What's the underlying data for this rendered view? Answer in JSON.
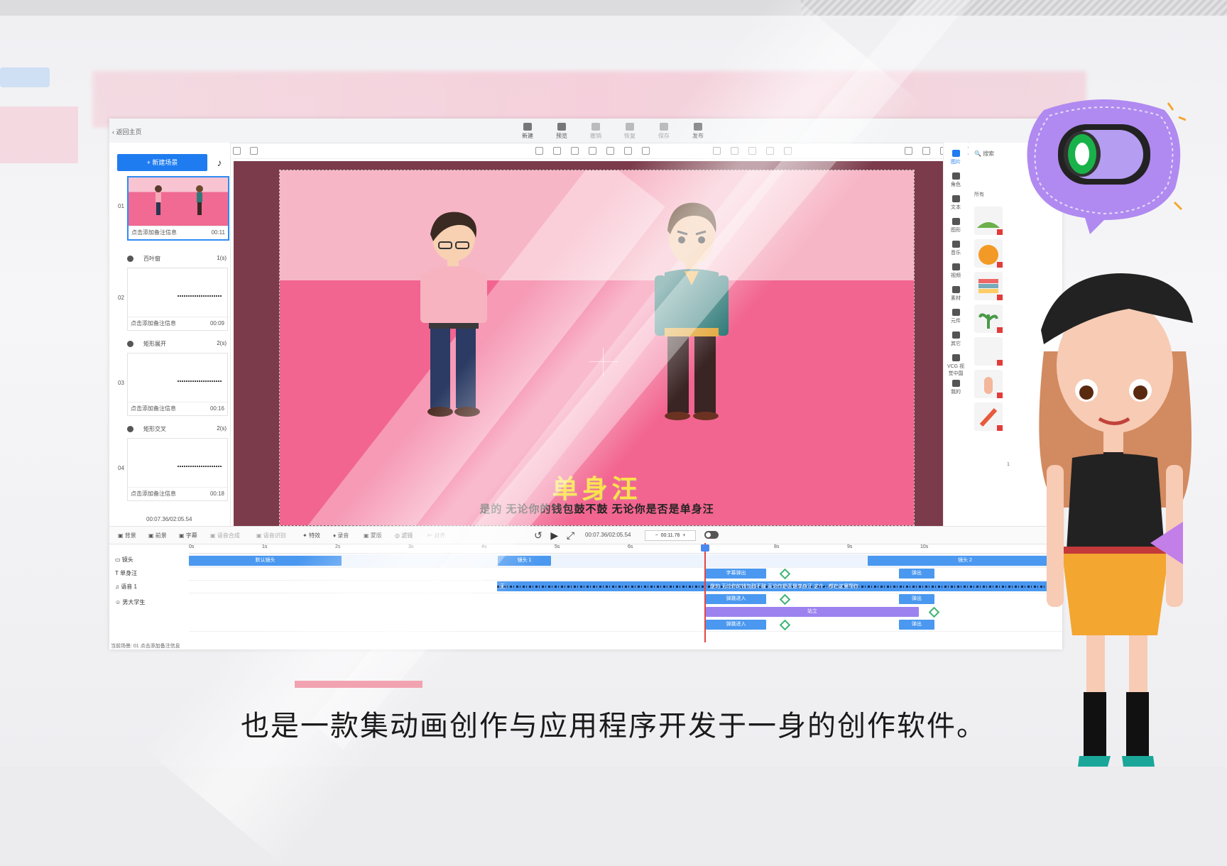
{
  "window": {
    "back_label": "返回主页"
  },
  "top_tools": [
    {
      "label": "新建",
      "icon": "new-icon",
      "enabled": true
    },
    {
      "label": "预览",
      "icon": "play-icon",
      "enabled": true
    },
    {
      "label": "撤销",
      "icon": "undo-icon",
      "enabled": false
    },
    {
      "label": "恢复",
      "icon": "redo-icon",
      "enabled": false
    },
    {
      "label": "保存",
      "icon": "save-icon",
      "enabled": false
    },
    {
      "label": "发布",
      "icon": "publish-icon",
      "enabled": true
    }
  ],
  "scenes_panel": {
    "new_scene_label": "+ 新建场景",
    "scenes": [
      {
        "num": "01",
        "note": "点击添加备注信息",
        "duration": "00:11"
      },
      {
        "num": "02",
        "note": "点击添加备注信息",
        "duration": "00:09"
      },
      {
        "num": "03",
        "note": "点击添加备注信息",
        "duration": "00:16"
      },
      {
        "num": "04",
        "note": "点击添加备注信息",
        "duration": "00:18"
      }
    ],
    "transitions": [
      {
        "name": "百叶窗",
        "duration": "1(s)"
      },
      {
        "name": "矩形展开",
        "duration": "2(s)"
      },
      {
        "name": "矩形交叉",
        "duration": "2(s)"
      }
    ],
    "total_time": "00:07.36/02:05.54"
  },
  "canvas": {
    "title": "单身汪",
    "subtitle": "是的 无论你的钱包鼓不鼓 无论你是否是单身汪"
  },
  "right_tabs": [
    {
      "label": "图片",
      "icon": "image-icon",
      "active": true
    },
    {
      "label": "角色",
      "icon": "character-icon",
      "active": false
    },
    {
      "label": "文本",
      "icon": "text-icon",
      "active": false
    },
    {
      "label": "图形",
      "icon": "shape-icon",
      "active": false
    },
    {
      "label": "音乐",
      "icon": "music-icon",
      "active": false
    },
    {
      "label": "视频",
      "icon": "video-icon",
      "active": false
    },
    {
      "label": "素材",
      "icon": "folder-icon",
      "active": false
    },
    {
      "label": "元件",
      "icon": "component-icon",
      "active": false
    },
    {
      "label": "其它",
      "icon": "grid-icon",
      "active": false
    },
    {
      "label": "VCG 视觉中国",
      "icon": "vcg-icon",
      "active": false
    },
    {
      "label": "我的",
      "icon": "user-icon",
      "active": false
    }
  ],
  "right_panel": {
    "search_placeholder": "搜索",
    "filter": "所有",
    "page": "1"
  },
  "timeline": {
    "tools": [
      "背景",
      "前景",
      "字幕",
      "语音合成",
      "语音识别",
      "特效",
      "录音",
      "蒙版",
      "滤镜",
      "对齐"
    ],
    "current_time": "00:07.36/02:05.54",
    "zoom_value": "00:11.76",
    "ruler": [
      "0s",
      "1s",
      "2s",
      "3s",
      "4s",
      "5s",
      "6s",
      "7s",
      "8s",
      "9s",
      "10s"
    ],
    "tracks": [
      {
        "name": "镜头"
      },
      {
        "name": "单身汪"
      },
      {
        "name": "语音 1"
      },
      {
        "name": "男大学生"
      }
    ],
    "clips": {
      "camera_default": "默认镜头",
      "camera_1": "镜头 1",
      "camera_2": "镜头 2",
      "text_in": "字幕弹出",
      "text_out": "弹出",
      "voice_text": "是的 无论你的钱包鼓不鼓 无论你是否是单身汪 这个…都在这里帮你",
      "voice_start": "无",
      "char_in": "弹跳进入",
      "char_out": "弹出",
      "char_action": "站立",
      "char2_in": "弹跳进入",
      "char2_out": "弹出"
    },
    "status": "当前场景: 01  点击添加备注信息"
  },
  "caption": "也是一款集动画创作与应用程序开发于一身的创作软件。",
  "colors": {
    "accent": "#1f7cf0",
    "stage_pink": "#f26590",
    "title_yellow": "#ffe24a",
    "presenter_purple": "#b08af0"
  }
}
